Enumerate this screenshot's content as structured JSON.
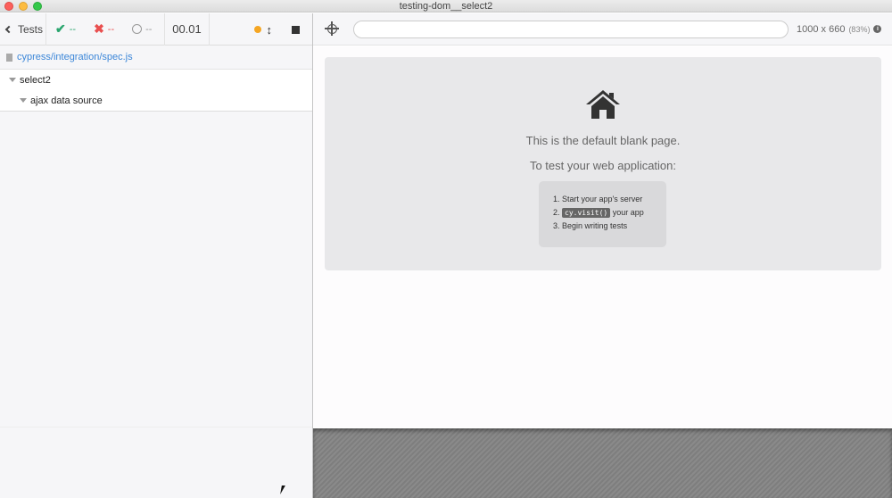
{
  "window": {
    "title": "testing-dom__select2"
  },
  "reporter": {
    "tests_button_label": "Tests",
    "stats": {
      "passed": "--",
      "failed": "--",
      "pending": "--",
      "duration": "00.01"
    },
    "spec_path": "cypress/integration/spec.js",
    "suites": [
      {
        "title": "select2",
        "level": 1
      },
      {
        "title": "ajax data source",
        "level": 2
      }
    ],
    "colors": {
      "passed": "#2aa56e",
      "failed": "#e94f4f",
      "running_dot": "#f5a623",
      "spec_link": "#3b86d8"
    }
  },
  "runner": {
    "url": "",
    "viewport": "1000 x 660",
    "scale": "(83%)",
    "blank_page": {
      "title": "This is the default blank page.",
      "subtitle": "To test your web application:",
      "steps": [
        {
          "num": "1.",
          "text": "Start your app's server",
          "code": ""
        },
        {
          "num": "2.",
          "code": "cy.visit()",
          "text": " your app"
        },
        {
          "num": "3.",
          "text": "Begin writing tests",
          "code": ""
        }
      ]
    }
  },
  "icons": {
    "back": "chevron-left-icon",
    "passed": "check-icon",
    "failed": "x-icon",
    "pending": "circle-icon",
    "running": "status-dot-icon",
    "auto_scroll": "arrows-vertical-icon",
    "stop": "stop-icon",
    "selector_playground": "crosshair-icon",
    "viewport_info": "info-icon",
    "home": "home-icon",
    "file": "file-icon"
  }
}
